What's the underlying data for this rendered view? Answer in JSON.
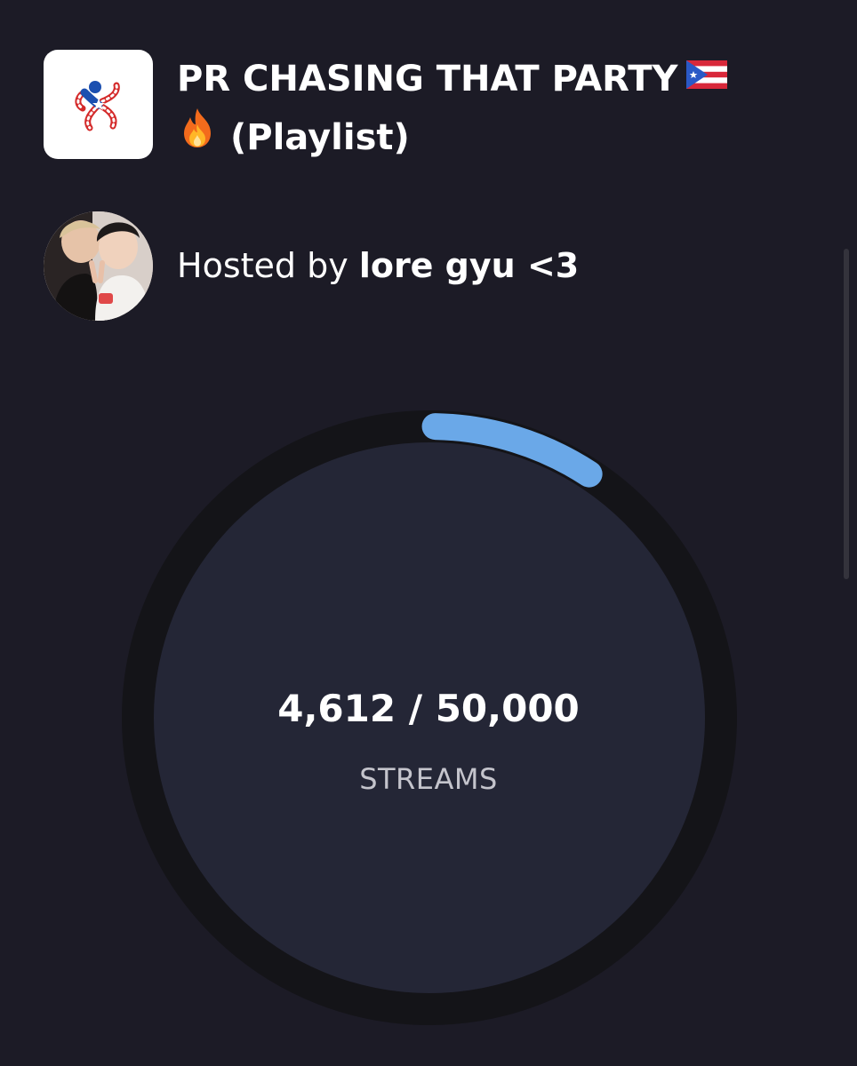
{
  "playlist": {
    "title": "PR CHASING THAT PARTY",
    "title_suffix": "(Playlist)",
    "title_emojis": [
      "puerto-rico-flag-icon",
      "fire-icon"
    ]
  },
  "host": {
    "prefix": "Hosted by",
    "name": "lore gyu <3"
  },
  "progress": {
    "current_label": "4,612",
    "goal_label": "50,000",
    "separator": " / ",
    "unit": "STREAMS",
    "current": 4612,
    "goal": 50000
  },
  "colors": {
    "background": "#1c1b26",
    "ring_track": "#141418",
    "ring_inner": "#242636",
    "ring_fill": "#6aa8e8"
  }
}
